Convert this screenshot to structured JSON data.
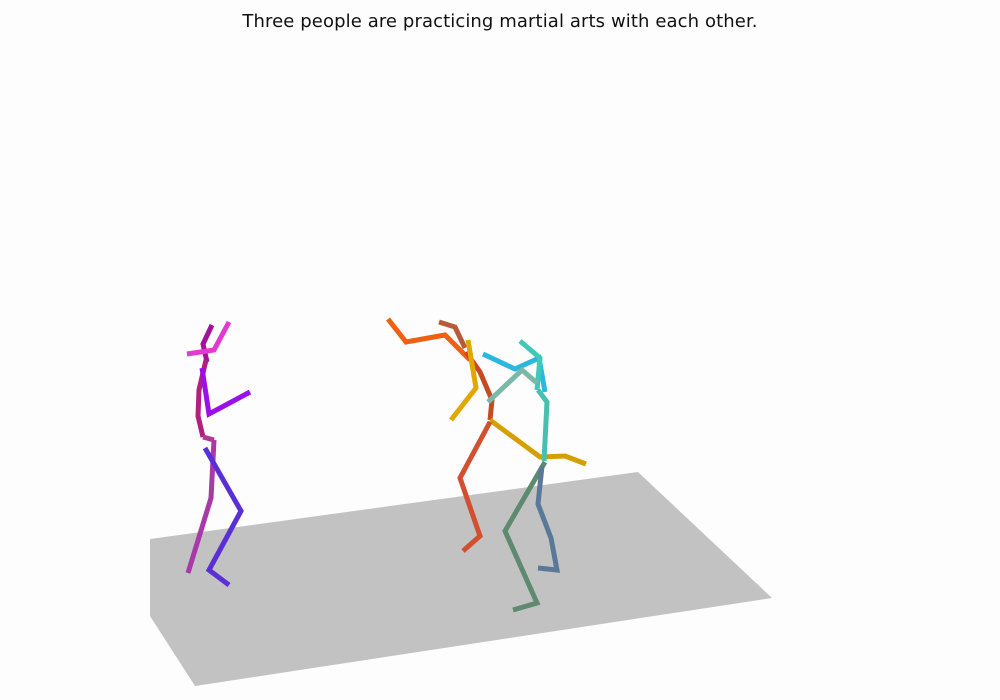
{
  "caption": "Three people are practicing martial arts with each other.",
  "colors": {
    "background": "#fdfdfd",
    "floor": "#c2c2c2",
    "person_left": [
      "#a0149c",
      "#e03ad0",
      "#9b10e8",
      "#5b2fd6",
      "#a73aa8"
    ],
    "person_middle": [
      "#f06010",
      "#c84a20",
      "#e0a800",
      "#b95a45"
    ],
    "person_right": [
      "#2ab8e0",
      "#40c8b8",
      "#7ab8a8",
      "#5e8a70",
      "#5a7898"
    ]
  }
}
